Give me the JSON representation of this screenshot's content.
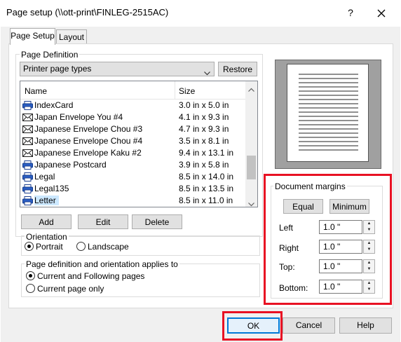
{
  "window": {
    "title": "Page setup (\\\\ott-print\\FINLEG-2515AC)",
    "help_label": "?",
    "close_icon": "close-icon"
  },
  "tabs": [
    {
      "label": "Page Setup",
      "active": true
    },
    {
      "label": "Layout",
      "active": false
    }
  ],
  "page_definition": {
    "legend": "Page Definition",
    "type_select": {
      "value": "Printer page types"
    },
    "restore_label": "Restore",
    "columns": [
      "Name",
      "Size"
    ],
    "rows": [
      {
        "name": "IndexCard",
        "size": "3.0 in x 5.0 in",
        "icon": "printer-icon"
      },
      {
        "name": "Japan Envelope You #4",
        "size": "4.1 in x 9.3 in",
        "icon": "envelope-icon"
      },
      {
        "name": "Japanese Envelope Chou #3",
        "size": "4.7 in x 9.3 in",
        "icon": "envelope-icon"
      },
      {
        "name": "Japanese Envelope Chou #4",
        "size": "3.5 in x 8.1 in",
        "icon": "envelope-icon"
      },
      {
        "name": "Japanese Envelope Kaku #2",
        "size": "9.4 in x 13.1 in",
        "icon": "envelope-icon"
      },
      {
        "name": "Japanese Postcard",
        "size": "3.9 in x 5.8 in",
        "icon": "printer-icon"
      },
      {
        "name": "Legal",
        "size": "8.5 in x 14.0 in",
        "icon": "printer-icon"
      },
      {
        "name": "Legal135",
        "size": "8.5 in x 13.5 in",
        "icon": "printer-icon"
      },
      {
        "name": "Letter",
        "size": "8.5 in x 11.0 in",
        "icon": "printer-icon",
        "selected": true
      }
    ],
    "add_label": "Add",
    "edit_label": "Edit",
    "delete_label": "Delete",
    "orientation": {
      "legend": "Orientation",
      "options": [
        "Portrait",
        "Landscape"
      ],
      "selected": "Portrait"
    },
    "applies": {
      "legend": "Page definition and orientation applies to",
      "options": [
        "Current and Following pages",
        "Current page only"
      ],
      "selected": "Current and Following pages"
    }
  },
  "margins": {
    "legend": "Document margins",
    "equal_label": "Equal",
    "minimum_label": "Minimum",
    "fields": [
      {
        "label": "Left",
        "value": "1.0 \""
      },
      {
        "label": "Right",
        "value": "1.0 \""
      },
      {
        "label": "Top:",
        "value": "1.0 \""
      },
      {
        "label": "Bottom:",
        "value": "1.0 \""
      }
    ]
  },
  "footer": {
    "ok_label": "OK",
    "cancel_label": "Cancel",
    "help_label": "Help"
  },
  "colors": {
    "highlight": "#e81123",
    "selection": "#cce8ff",
    "focus_border": "#0078d7",
    "dialog_bg": "#f0f0f0"
  }
}
